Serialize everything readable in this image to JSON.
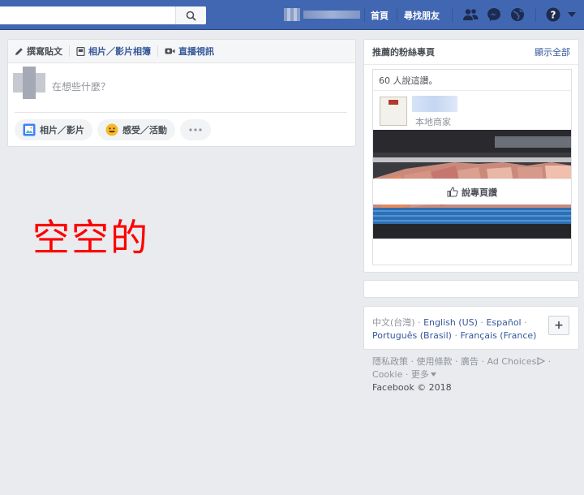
{
  "topbar": {
    "search_placeholder": "",
    "nav": {
      "home": "首頁",
      "find_friends": "尋找朋友"
    }
  },
  "composer": {
    "tabs": [
      {
        "label": "撰寫貼文"
      },
      {
        "label": "相片／影片相簿"
      },
      {
        "label": "直播視訊"
      }
    ],
    "placeholder": "在想些什麼？",
    "actions": [
      {
        "label": "相片／影片"
      },
      {
        "label": "感受／活動"
      }
    ]
  },
  "main": {
    "empty_text": "空空的"
  },
  "recommended": {
    "title": "推薦的粉絲專頁",
    "see_all": "顯示全部",
    "likes_text": "60 人說這讚。",
    "page_category": "本地商家",
    "like_button": "說專頁讚"
  },
  "languages": {
    "current": "中文(台灣)",
    "options": [
      "English (US)",
      "Español",
      "Português (Brasil)",
      "Français (France)"
    ],
    "add_label": "+"
  },
  "footer": {
    "links": [
      "隱私政策",
      "使用條款",
      "廣告",
      "Ad Choices",
      "Cookie",
      "更多"
    ],
    "copyright": "Facebook © 2018"
  },
  "colors": {
    "brand": "#4267b2",
    "link": "#365899",
    "background": "#e9ebee",
    "annotation": "#ff0000"
  }
}
